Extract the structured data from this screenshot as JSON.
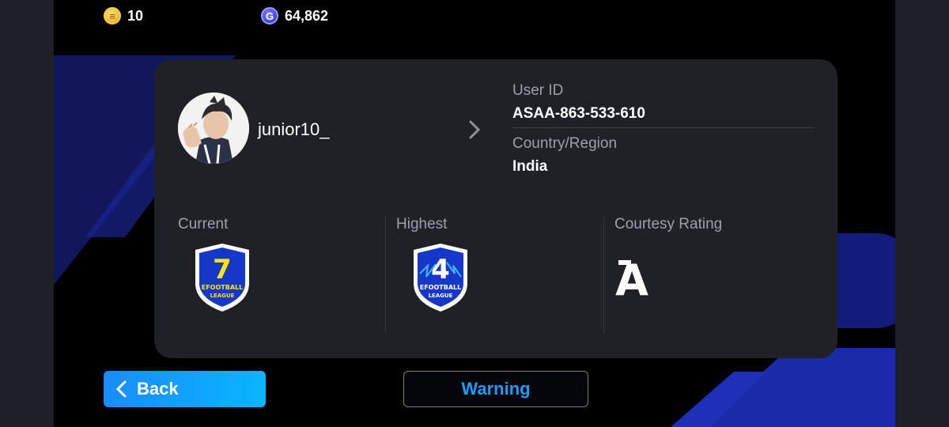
{
  "currency": {
    "coins": {
      "icon": "efootball-coin-icon",
      "value": "10"
    },
    "gp": {
      "icon": "gp-icon",
      "symbol": "G",
      "value": "64,862"
    }
  },
  "profile": {
    "username": "junior10_",
    "user_id_label": "User ID",
    "user_id": "ASAA-863-533-610",
    "country_label": "Country/Region",
    "country": "India"
  },
  "ratings": {
    "current_label": "Current",
    "current_division": "7",
    "current_badge_text_line1": "EFOOTBALL",
    "current_badge_text_line2": "LEAGUE",
    "highest_label": "Highest",
    "highest_division": "4",
    "highest_badge_text_line1": "EFOOTBALL",
    "highest_badge_text_line2": "LEAGUE",
    "courtesy_label": "Courtesy Rating",
    "courtesy_grade": "A"
  },
  "buttons": {
    "back_label": "Back",
    "warning_label": "Warning"
  },
  "colors": {
    "accent_blue": "#1e9bff",
    "badge_blue": "#1538c8",
    "badge_yellow": "#ffe600"
  }
}
